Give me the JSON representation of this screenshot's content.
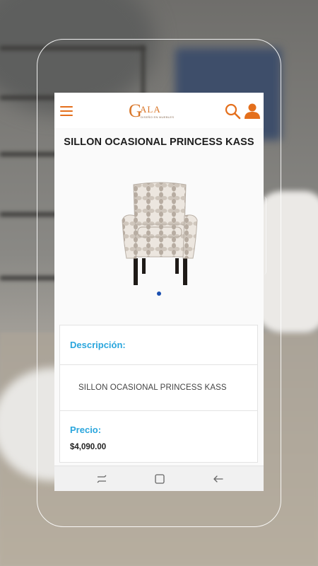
{
  "header": {
    "logo_letter": "G",
    "logo_text": "ALA",
    "logo_tagline": "DISEÑO EN MUEBLES",
    "menu_icon": "hamburger-menu-icon",
    "search_icon": "search-icon",
    "user_icon": "user-icon",
    "accent_color": "#e46f1c"
  },
  "product": {
    "title": "SILLON OCASIONAL PRINCESS KASS",
    "image": "armchair-image",
    "carousel_active_index": 0,
    "carousel_count": 1
  },
  "details": {
    "description_label": "Descripción:",
    "description_text": "SILLON OCASIONAL PRINCESS KASS",
    "price_label": "Precio:",
    "price_value": "$4,090.00",
    "label_color": "#2aa6dd"
  },
  "navbar": {
    "recent_icon": "recent-apps-icon",
    "home_icon": "home-icon",
    "back_icon": "back-arrow-icon"
  }
}
